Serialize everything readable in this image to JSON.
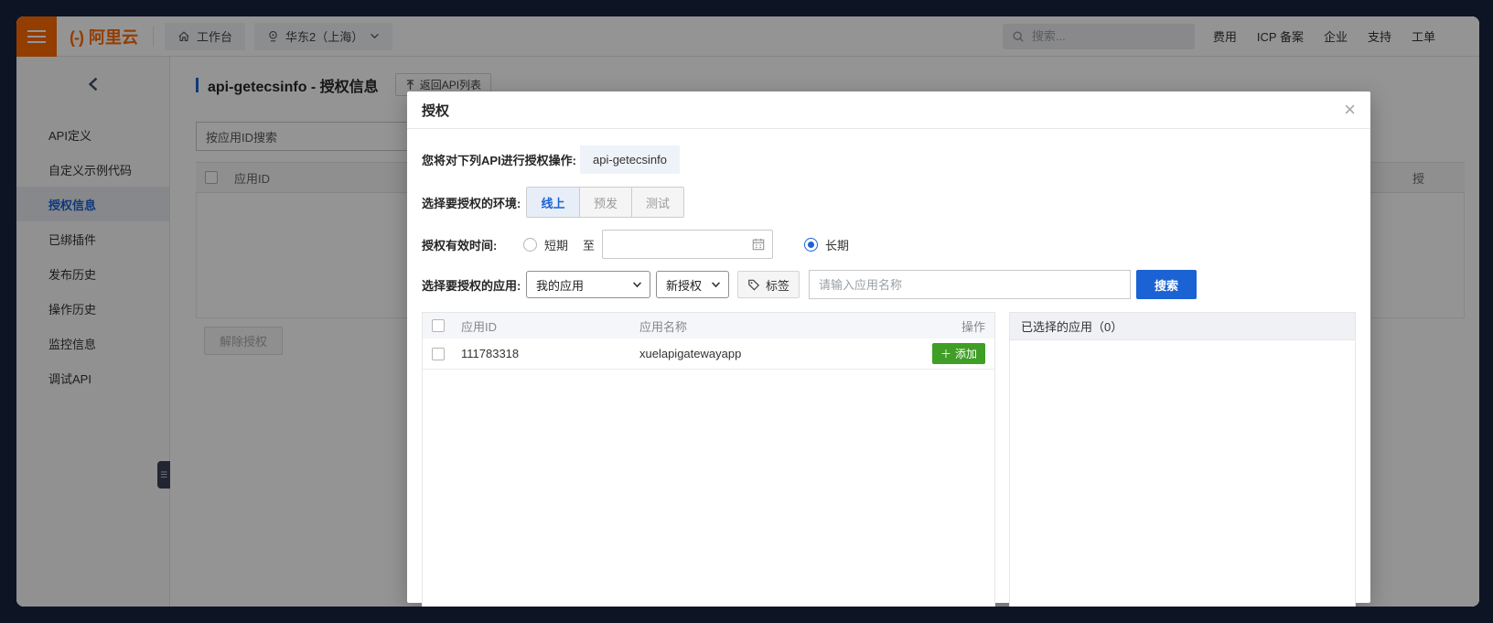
{
  "topbar": {
    "logo_mark": "(-)",
    "logo_text": "阿里云",
    "workbench": "工作台",
    "region": "华东2（上海）",
    "search_placeholder": "搜索...",
    "links": [
      "费用",
      "ICP 备案",
      "企业",
      "支持",
      "工单"
    ]
  },
  "sidebar": {
    "items": [
      {
        "label": "API定义",
        "active": false
      },
      {
        "label": "自定义示例代码",
        "active": false
      },
      {
        "label": "授权信息",
        "active": true
      },
      {
        "label": "已绑插件",
        "active": false
      },
      {
        "label": "发布历史",
        "active": false
      },
      {
        "label": "操作历史",
        "active": false
      },
      {
        "label": "监控信息",
        "active": false
      },
      {
        "label": "调试API",
        "active": false
      }
    ]
  },
  "page": {
    "title": "api-getecsinfo - 授权信息",
    "back_button": "返回API列表",
    "search_value": "按应用ID搜索",
    "table": {
      "col_app_id": "应用ID",
      "col_partial": "授",
      "unbind_button": "解除授权"
    }
  },
  "modal": {
    "title": "授权",
    "api_label": "您将对下列API进行授权操作:",
    "api_value": "api-getecsinfo",
    "env_label": "选择要授权的环境:",
    "env_options": [
      {
        "label": "线上",
        "active": true
      },
      {
        "label": "预发",
        "active": false
      },
      {
        "label": "测试",
        "active": false
      }
    ],
    "time_label": "授权有效时间:",
    "time_short": "短期",
    "time_to": "至",
    "time_long": "长期",
    "time_long_checked": true,
    "app_label": "选择要授权的应用:",
    "app_source_select": "我的应用",
    "auth_type_select": "新授权",
    "tag_button": "标签",
    "app_name_placeholder": "请输入应用名称",
    "search_button": "搜索",
    "table": {
      "col_app_id": "应用ID",
      "col_app_name": "应用名称",
      "col_action": "操作",
      "rows": [
        {
          "app_id": "111783318",
          "app_name": "xuelapigatewayapp",
          "action": "添加",
          "action_plus": "＋"
        }
      ]
    },
    "selected_panel_title": "已选择的应用（0）"
  },
  "colors": {
    "brand_orange": "#FF6A00",
    "primary_blue": "#1B62D4",
    "action_green": "#3F9E26",
    "frame_dark": "#0D1524",
    "overlay": "rgba(0,0,0,0.42)"
  },
  "icons": {
    "hamburger": "menu-icon",
    "home": "home-icon",
    "pin": "location-pin-icon",
    "magnifier": "search-icon",
    "back_arrow": "back-to-list-icon",
    "calendar": "calendar-icon",
    "tag": "tag-icon",
    "chevron_down": "chevron-down-icon",
    "chevron_left": "collapse-sidebar-icon",
    "close": "close-icon"
  }
}
